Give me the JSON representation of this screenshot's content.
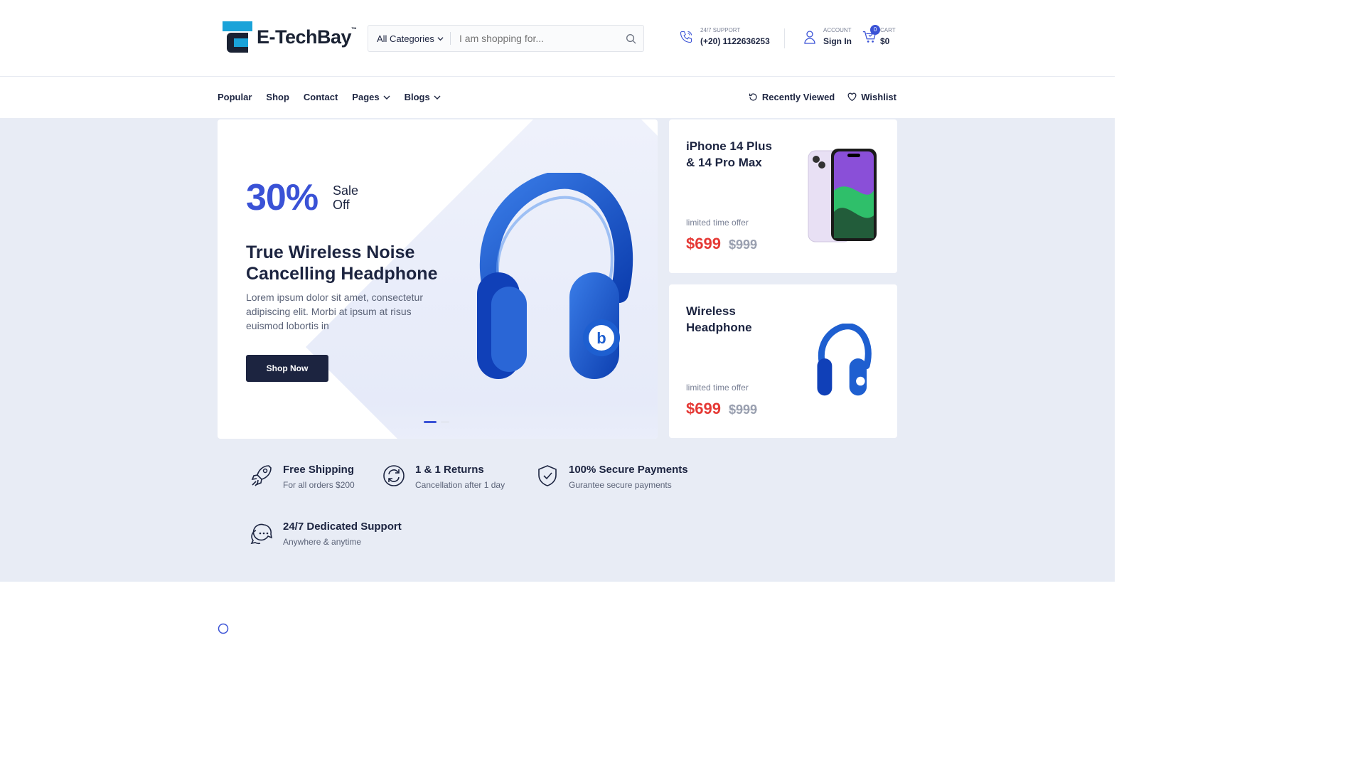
{
  "brand": {
    "name": "E-TechBay",
    "tm": "™"
  },
  "search": {
    "category": "All Categories",
    "placeholder": "I am shopping for..."
  },
  "support": {
    "label": "24/7 SUPPORT",
    "phone": "(+20) 1122636253"
  },
  "account": {
    "label": "ACCOUNT",
    "action": "Sign In"
  },
  "cart": {
    "label": "CART",
    "total": "$0",
    "count": "0"
  },
  "nav": {
    "items": [
      "Popular",
      "Shop",
      "Contact",
      "Pages",
      "Blogs"
    ],
    "recently_viewed": "Recently Viewed",
    "wishlist": "Wishlist"
  },
  "hero": {
    "percent": "30%",
    "sale_line1": "Sale",
    "sale_line2": "Off",
    "title": "True Wireless Noise Cancelling Headphone",
    "description": "Lorem ipsum dolor sit amet, consectetur adipiscing elit. Morbi at ipsum at risus euismod lobortis in",
    "button": "Shop Now",
    "active_slide": 1,
    "slide_count": 2
  },
  "promos": [
    {
      "title": "iPhone 14 Plus & 14 Pro Max",
      "limited": "limited time offer",
      "price": "$699",
      "old_price": "$999"
    },
    {
      "title": "Wireless Headphone",
      "limited": "limited time offer",
      "price": "$699",
      "old_price": "$999"
    }
  ],
  "features": [
    {
      "title": "Free Shipping",
      "subtitle": "For all orders $200",
      "icon": "rocket-icon"
    },
    {
      "title": "1 & 1 Returns",
      "subtitle": "Cancellation after 1 day",
      "icon": "refresh-icon"
    },
    {
      "title": "100% Secure Payments",
      "subtitle": "Gurantee secure payments",
      "icon": "shield-check-icon"
    },
    {
      "title": "24/7 Dedicated Support",
      "subtitle": "Anywhere & anytime",
      "icon": "chat-bubbles-icon"
    }
  ],
  "colors": {
    "accent": "#3a52d6",
    "dark": "#1c2440",
    "sale": "#e53935",
    "bg": "#e8ecf5"
  }
}
